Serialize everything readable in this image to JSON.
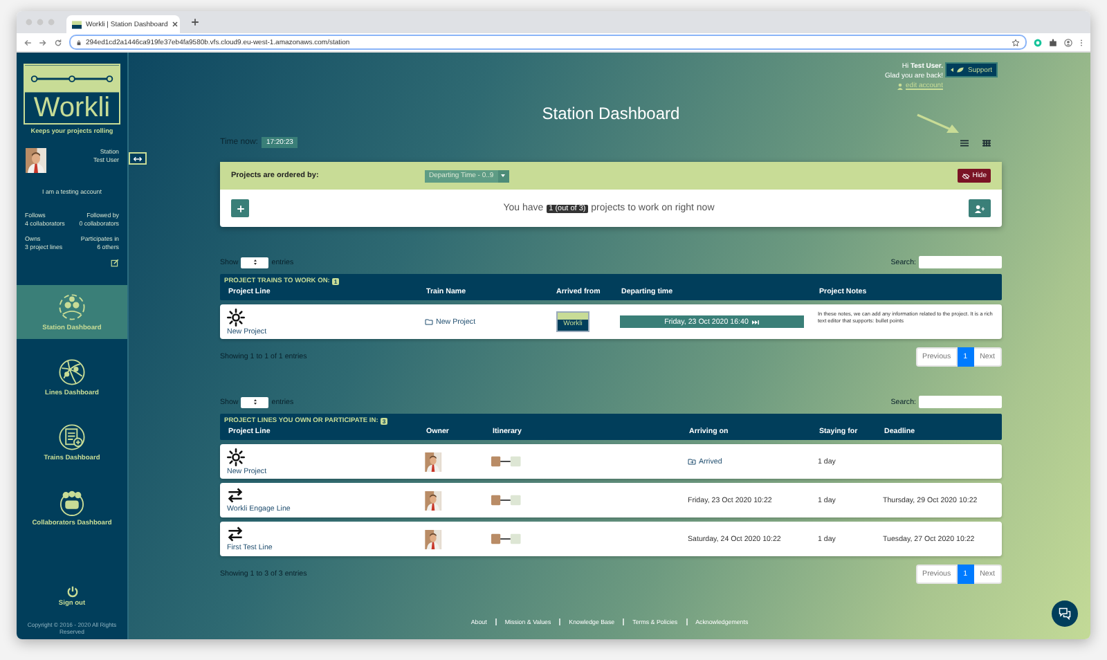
{
  "browser": {
    "tab_title": "Workli | Station Dashboard",
    "url": "294ed1cd2a1446ca919fe37eb4fa9580b.vfs.cloud9.eu-west-1.amazonaws.com/station"
  },
  "sidebar": {
    "logo": "Workli",
    "tagline": "Keeps your projects rolling",
    "profile": {
      "role": "Station",
      "name": "Test User",
      "bio": "I am a testing account"
    },
    "stats": [
      {
        "label": "Follows",
        "value": "4 collaborators"
      },
      {
        "label": "Followed by",
        "value": "0 collaborators"
      },
      {
        "label": "Owns",
        "value": "3 project lines"
      },
      {
        "label": "Participates in",
        "value": "6 others"
      }
    ],
    "nav": [
      {
        "label": "Station Dashboard",
        "kind": "station",
        "selected": true
      },
      {
        "label": "Lines Dashboard",
        "kind": "lines",
        "selected": false
      },
      {
        "label": "Trains Dashboard",
        "kind": "trains",
        "selected": false
      },
      {
        "label": "Collaborators Dashboard",
        "kind": "collaborators",
        "selected": false
      }
    ],
    "sign_out": "Sign out",
    "copyright": "Copyright © 2016 - 2020 All Rights Reserved"
  },
  "header": {
    "greeting": "Hi **Test User.**",
    "welcome": "Glad you are back!",
    "edit_account": "edit account",
    "support": "Support",
    "title": "Station Dashboard",
    "time_label": "Time now:",
    "time": "17:20:23"
  },
  "order_card": {
    "label": "Projects are ordered by:",
    "order": "Departing Time - 0..9",
    "hide": "Hide",
    "summary_before": "You have",
    "count": "1 (out of 3)",
    "summary_after": "projects to work on right now"
  },
  "trains_table": {
    "show": "Show",
    "entries": "entries",
    "search": "Search:",
    "caption": "PROJECT TRAINS TO WORK ON:",
    "caption_count": "1",
    "columns": [
      "Project Line",
      "Train Name",
      "Arrived from",
      "Departing time",
      "Project Notes"
    ],
    "rows": [
      {
        "kind": "new",
        "project": "New Project",
        "train": "New Project",
        "arrived_from": "Workli",
        "departing": "Friday, 23 Oct 2020 16:40",
        "notes": "In these notes, we can add any information related to the project. It is a rich text editor that supports: bullet points"
      }
    ],
    "info": "Showing 1 to 1 of 1 entries",
    "pagination": [
      {
        "label": "Previous",
        "selected": false
      },
      {
        "label": "1",
        "selected": true
      },
      {
        "label": "Next",
        "selected": false
      }
    ]
  },
  "lines_table": {
    "show": "Show",
    "entries": "entries",
    "search": "Search:",
    "caption": "PROJECT LINES YOU OWN OR PARTICIPATE IN:",
    "caption_count": "3",
    "columns": [
      "Project Line",
      "Owner",
      "Itinerary",
      "Arriving on",
      "Staying for",
      "Deadline"
    ],
    "rows": [
      {
        "kind": "new",
        "project": "New Project",
        "arriving": "Arrived",
        "arrived": true,
        "staying": "1 day"
      },
      {
        "kind": "line",
        "project": "Workli Engage Line",
        "arriving": "Friday, 23 Oct 2020 10:22",
        "arrived": false,
        "staying": "1 day",
        "deadline": "Thursday, 29 Oct 2020 10:22"
      },
      {
        "kind": "line",
        "project": "First Test Line",
        "arriving": "Saturday, 24 Oct 2020 10:22",
        "arrived": false,
        "staying": "1 day",
        "deadline": "Tuesday, 27 Oct 2020 10:22"
      }
    ],
    "info": "Showing 1 to 3 of 3 entries",
    "pagination": [
      {
        "label": "Previous",
        "selected": false
      },
      {
        "label": "1",
        "selected": true
      },
      {
        "label": "Next",
        "selected": false
      }
    ]
  },
  "footer": [
    "About",
    "Mission & Values",
    "Knowledge Base",
    "Terms & Policies",
    "Acknowledgements"
  ]
}
